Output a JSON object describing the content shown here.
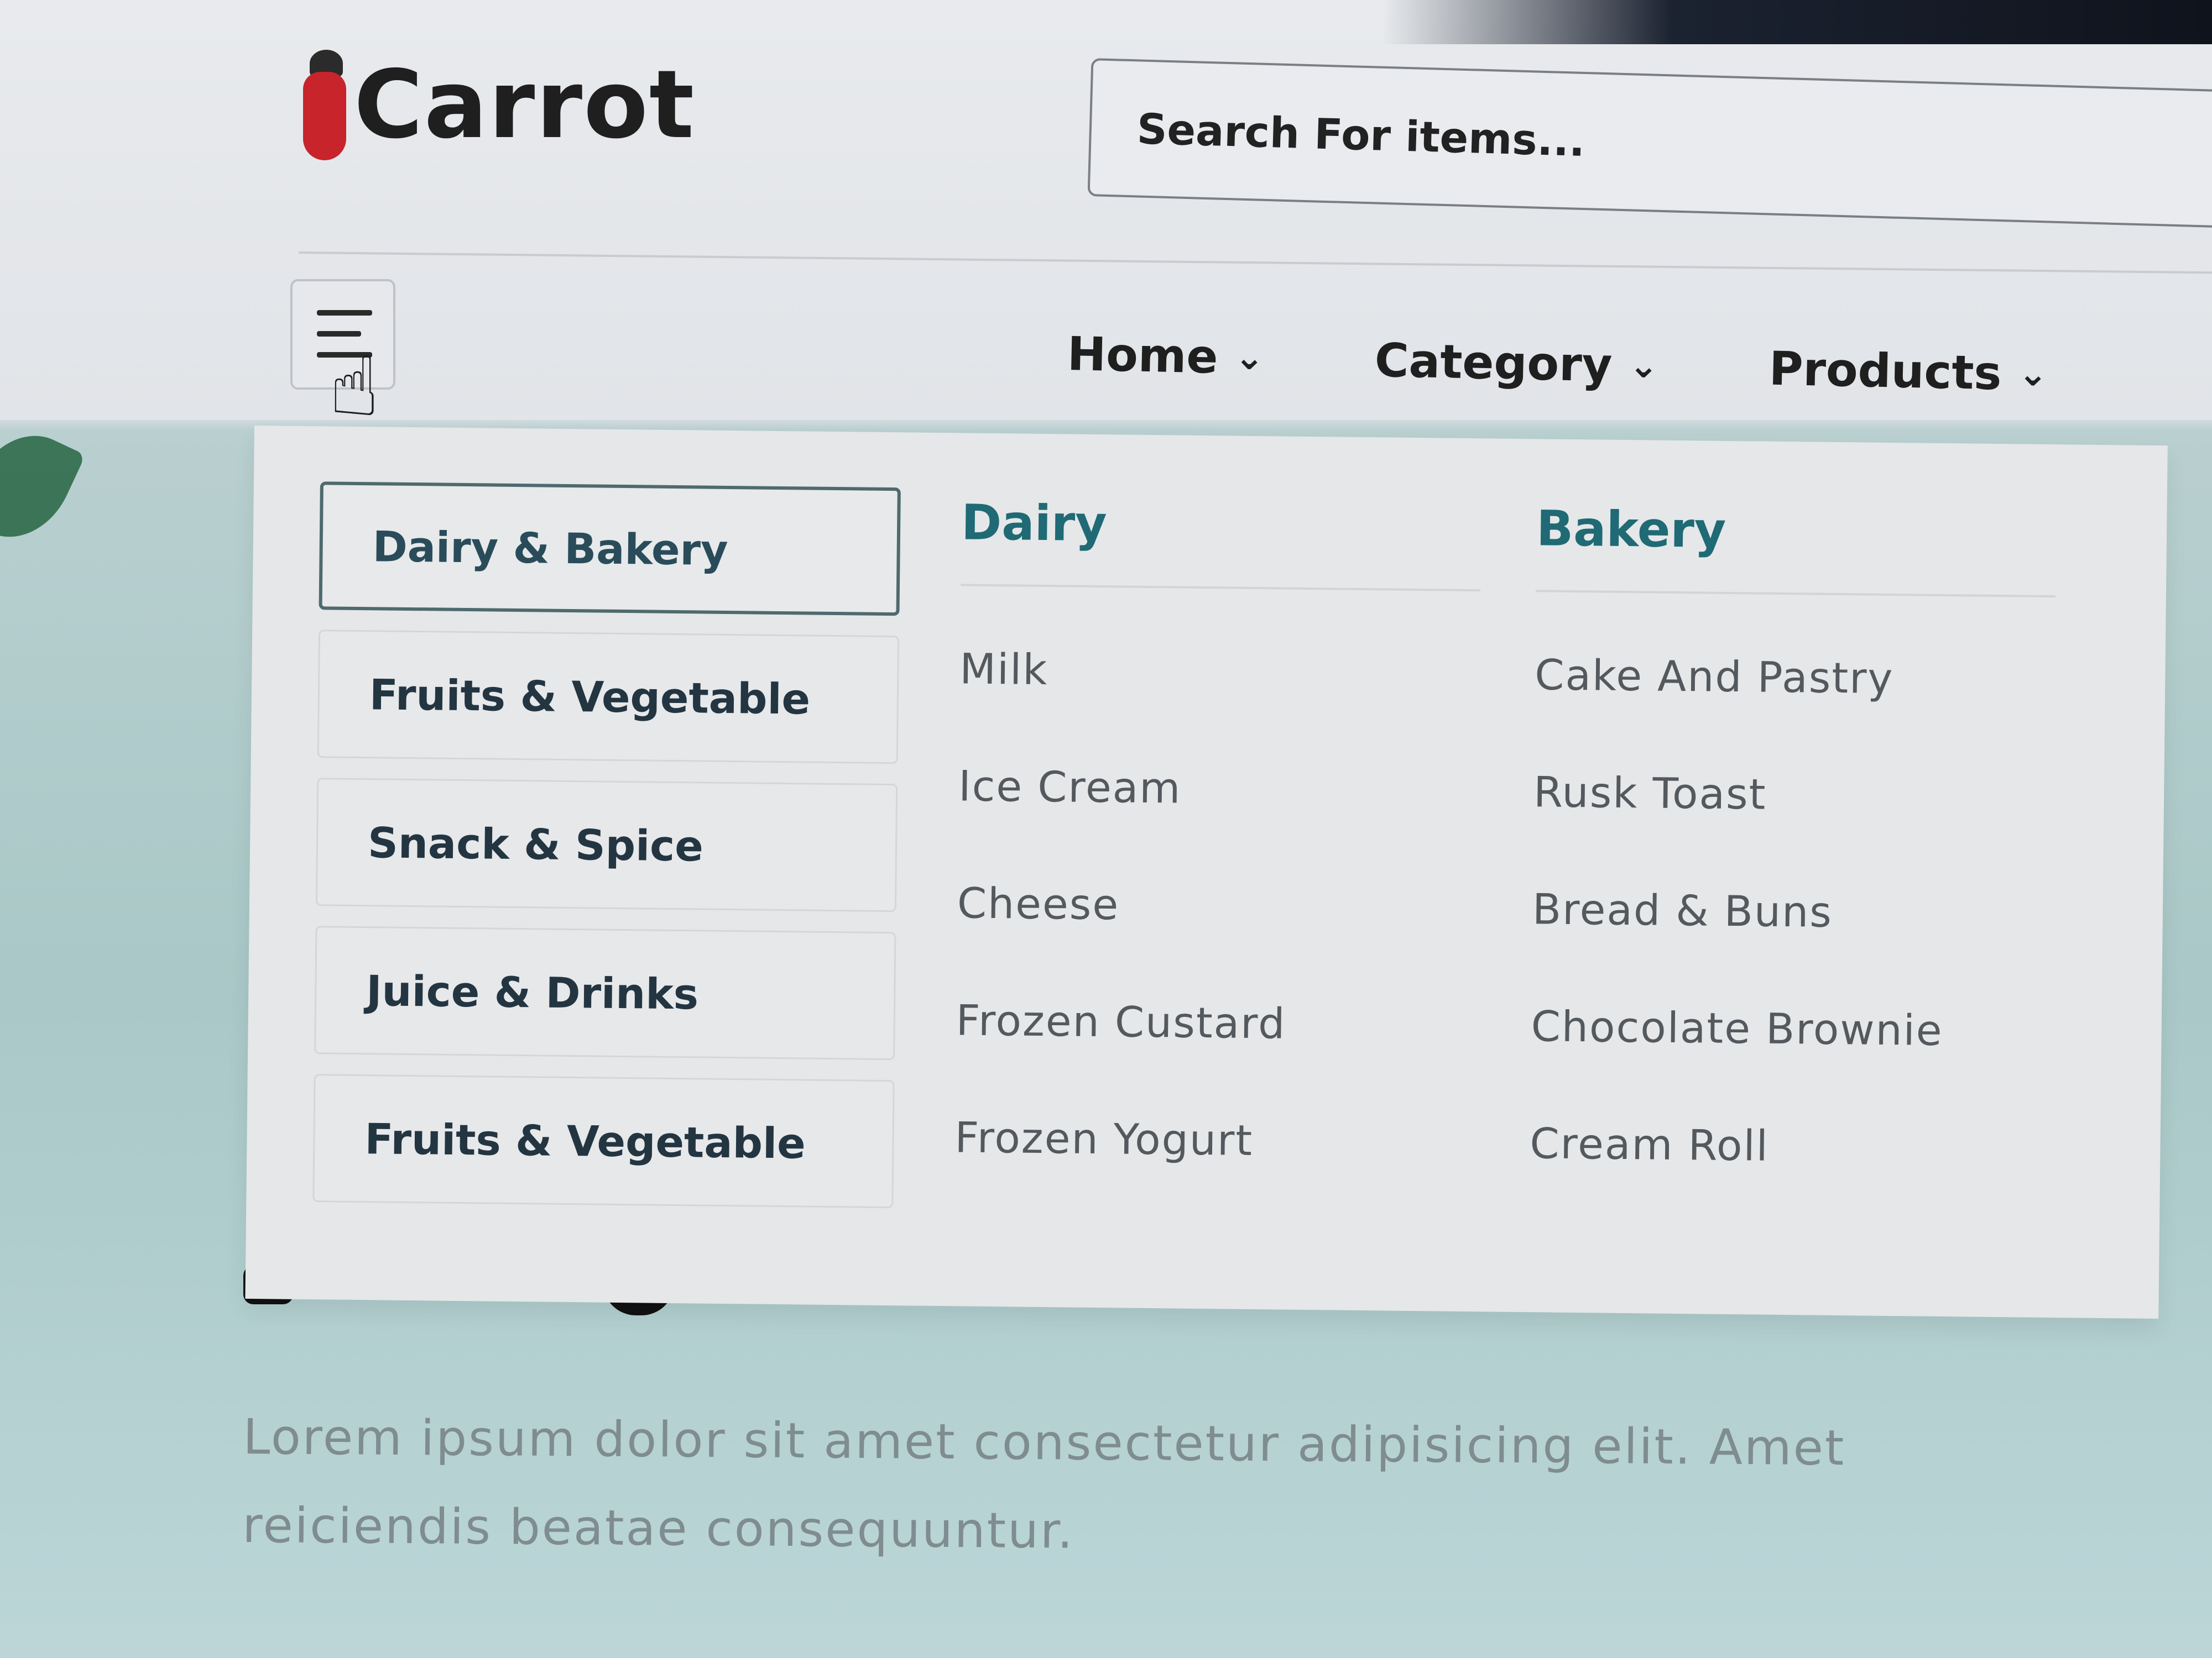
{
  "brand": {
    "name": "Carrot",
    "logo_icon": "carrot-icon",
    "accent_color": "#c8242b"
  },
  "search": {
    "placeholder": "Search For items..."
  },
  "nav": {
    "menu_icon": "hamburger-menu-icon",
    "items": [
      {
        "label": "Home",
        "icon": "chevron-down-icon"
      },
      {
        "label": "Category",
        "icon": "chevron-down-icon"
      },
      {
        "label": "Products",
        "icon": "chevron-down-icon"
      }
    ]
  },
  "mega_menu": {
    "categories": [
      {
        "label": "Dairy & Bakery",
        "active": true
      },
      {
        "label": "Fruits & Vegetable",
        "active": false
      },
      {
        "label": "Snack & Spice",
        "active": false
      },
      {
        "label": "Juice & Drinks",
        "active": false
      },
      {
        "label": "Fruits & Vegetable",
        "active": false
      }
    ],
    "columns": [
      {
        "title": "Dairy",
        "links": [
          "Milk",
          "Ice Cream",
          "Cheese",
          "Frozen Custard",
          "Frozen Yogurt"
        ]
      },
      {
        "title": "Bakery",
        "links": [
          "Cake And Pastry",
          "Rusk Toast",
          "Bread & Buns",
          "Chocolate Brownie",
          "Cream Roll"
        ]
      }
    ],
    "title_color": "#1f6a74"
  },
  "hero": {
    "body": "Lorem ipsum dolor sit amet consectetur adipisicing elit. Amet reiciendis beatae consequuntur."
  }
}
